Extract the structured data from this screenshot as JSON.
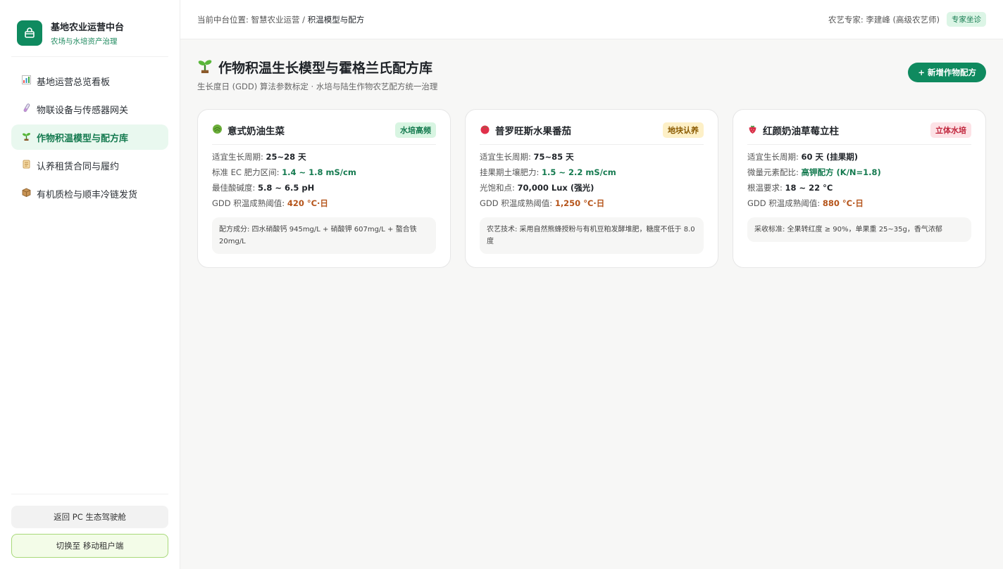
{
  "brand": {
    "title": "基地农业运营中台",
    "subtitle": "农场与水培资产治理"
  },
  "sidebar": {
    "items": [
      {
        "icon": "bar-chart-icon",
        "label": "基地运营总览看板",
        "active": false
      },
      {
        "icon": "test-tube-icon",
        "label": "物联设备与传感器网关",
        "active": false
      },
      {
        "icon": "seedling-icon",
        "label": "作物积温模型与配方库",
        "active": true
      },
      {
        "icon": "scroll-icon",
        "label": "认养租赁合同与履约",
        "active": false
      },
      {
        "icon": "package-icon",
        "label": "有机质检与顺丰冷链发货",
        "active": false
      }
    ],
    "back_button": "返回 PC 生态驾驶舱",
    "mobile_button": "切换至 移动租户端"
  },
  "topbar": {
    "breadcrumb_prefix": "当前中台位置: ",
    "breadcrumb_parent": "智慧农业运营",
    "breadcrumb_sep": " / ",
    "breadcrumb_current": "积温模型与配方",
    "expert": "农艺专家: 李建峰 (高级农艺师)",
    "expert_badge": "专家坐诊"
  },
  "page": {
    "title": "作物积温生长模型与霍格兰氏配方库",
    "subtitle": "生长度日 (GDD) 算法参数标定 · 水培与陆生作物农艺配方统一治理",
    "add_button": "+ 新增作物配方"
  },
  "cards": [
    {
      "name": "意式奶油生菜",
      "icon": "lettuce-icon",
      "tag": "水培高频",
      "rows": [
        {
          "label": "适宜生长周期: ",
          "value": "25~28 天"
        },
        {
          "label": "标准 EC 肥力区间: ",
          "value": "1.4 ~ 1.8 mS/cm"
        },
        {
          "label": "最佳酸碱度: ",
          "value": "5.8 ~ 6.5 pH"
        },
        {
          "label": "GDD 积温成熟阈值: ",
          "value": "420 °C·日"
        }
      ],
      "note": "配方成分: 四水硝酸钙 945mg/L + 硝酸钾 607mg/L + 螯合铁 20mg/L"
    },
    {
      "name": "普罗旺斯水果番茄",
      "icon": "tomato-icon",
      "tag": "地块认养",
      "rows": [
        {
          "label": "适宜生长周期: ",
          "value": "75~85 天"
        },
        {
          "label": "挂果期土壤肥力: ",
          "value": "1.5 ~ 2.2 mS/cm"
        },
        {
          "label": "光饱和点: ",
          "value": "70,000 Lux (强光)"
        },
        {
          "label": "GDD 积温成熟阈值: ",
          "value": "1,250 °C·日"
        }
      ],
      "note": "农艺技术: 采用自然熊蜂授粉与有机豆粕发酵堆肥，糖度不低于 8.0 度"
    },
    {
      "name": "红颜奶油草莓立柱",
      "icon": "strawberry-icon",
      "tag": "立体水培",
      "rows": [
        {
          "label": "适宜生长周期: ",
          "value": "60 天 (挂果期)"
        },
        {
          "label": "微量元素配比: ",
          "value": "高钾配方 (K/N=1.8)"
        },
        {
          "label": "根温要求: ",
          "value": "18 ~ 22 °C"
        },
        {
          "label": "GDD 积温成熟阈值: ",
          "value": "880 °C·日"
        }
      ],
      "note": "采收标准: 全果转红度 ≥ 90%，单果重 25~35g，香气浓郁"
    }
  ]
}
